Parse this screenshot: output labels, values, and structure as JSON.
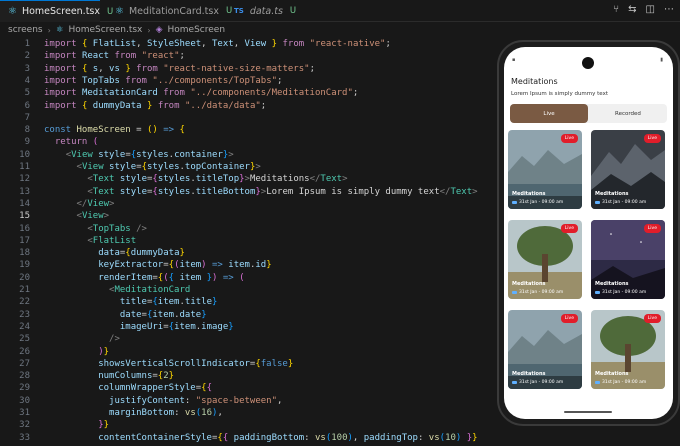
{
  "tabs": [
    {
      "label": "HomeScreen.tsx",
      "badge": "U",
      "icon": "react-icon"
    },
    {
      "label": "MeditationCard.tsx",
      "badge": "U",
      "icon": "react-icon"
    },
    {
      "label": "data.ts",
      "badge": "U",
      "icon": "ts-icon",
      "prefix": "TS"
    }
  ],
  "breadcrumb": [
    "screens",
    "HomeScreen.tsx",
    "HomeScreen"
  ],
  "line_numbers": [
    "1",
    "2",
    "3",
    "4",
    "5",
    "6",
    "7",
    "8",
    "9",
    "10",
    "11",
    "12",
    "13",
    "14",
    "15",
    "16",
    "17",
    "18",
    "19",
    "20",
    "21",
    "22",
    "23",
    "24",
    "25",
    "26",
    "27",
    "28",
    "29",
    "30",
    "31",
    "32",
    "33"
  ],
  "current_line": "15",
  "phone": {
    "title": "Meditations",
    "subtitle": "Lorem Ipsum is simply dummy text",
    "tab_live": "Live",
    "tab_recorded": "Recorded",
    "cards": [
      {
        "title": "Meditations",
        "date": "31st Jan - 09:00 am",
        "badge": "Live",
        "scene": "lake-mountains"
      },
      {
        "title": "Meditations",
        "date": "31st Jan - 09:00 am",
        "badge": "Live",
        "scene": "dark-mountains"
      },
      {
        "title": "Meditations",
        "date": "31st Jan - 09:00 am",
        "badge": "Live",
        "scene": "tree"
      },
      {
        "title": "Meditations",
        "date": "31st Jan - 09:00 am",
        "badge": "Live",
        "scene": "night-sky"
      },
      {
        "title": "Meditations",
        "date": "31st Jan - 09:00 am",
        "badge": "Live",
        "scene": "lake-mountains"
      },
      {
        "title": "Meditations",
        "date": "31st Jan - 09:00 am",
        "badge": "Live",
        "scene": "tree"
      }
    ]
  },
  "colors": {
    "accent": "#0078d4",
    "tab_selected": "#7a5a43",
    "live_badge": "#e11d2a"
  }
}
